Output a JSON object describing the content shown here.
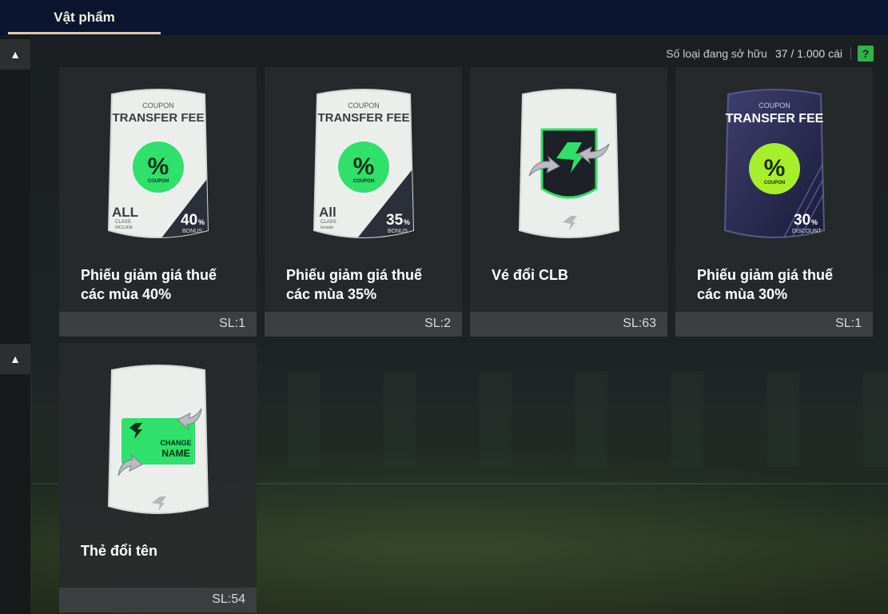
{
  "header": {
    "tab_label": "Vật phẩm"
  },
  "stats": {
    "label": "Số loại đang sở hữu",
    "value": "37 / 1.000 cái",
    "help": "?"
  },
  "collapse_icon": "▲",
  "items": [
    {
      "name": "Phiếu giảm giá thuế các mùa 40%",
      "qty": "SL:1",
      "card": {
        "top": "COUPON",
        "title": "TRANSFER FEE",
        "badge": "%",
        "badge_sub": "COUPON",
        "left_big": "ALL",
        "left_sub1": "CLASS",
        "left_sub2": "INCLUDE",
        "pct": "40",
        "pct_unit": "%",
        "pct_sub": "BONUS"
      }
    },
    {
      "name": "Phiếu giảm giá thuế các mùa 35%",
      "qty": "SL:2",
      "card": {
        "top": "COUPON",
        "title": "TRANSFER FEE",
        "badge": "%",
        "badge_sub": "COUPON",
        "left_big": "All",
        "left_sub1": "CLASS",
        "left_sub2": "Include",
        "pct": "35",
        "pct_unit": "%",
        "pct_sub": "BONUS"
      }
    },
    {
      "name": "Vé đổi CLB",
      "qty": "SL:63"
    },
    {
      "name": "Phiếu giảm giá thuế các mùa 30%",
      "qty": "SL:1",
      "card": {
        "top": "COUPON",
        "title": "TRANSFER FEE",
        "badge": "%",
        "badge_sub": "COUPON",
        "pct": "30",
        "pct_unit": "%",
        "pct_sub": "DISCOUNT"
      }
    },
    {
      "name": "Thẻ đổi tên",
      "qty": "SL:54",
      "card": {
        "line1": "CHANGE",
        "line2": "NAME"
      }
    }
  ],
  "colors": {
    "accent_green": "#2fe06a",
    "lime": "#a6ef2a",
    "header_bg": "#0b1530",
    "tab_underline": "#d7cfae"
  }
}
